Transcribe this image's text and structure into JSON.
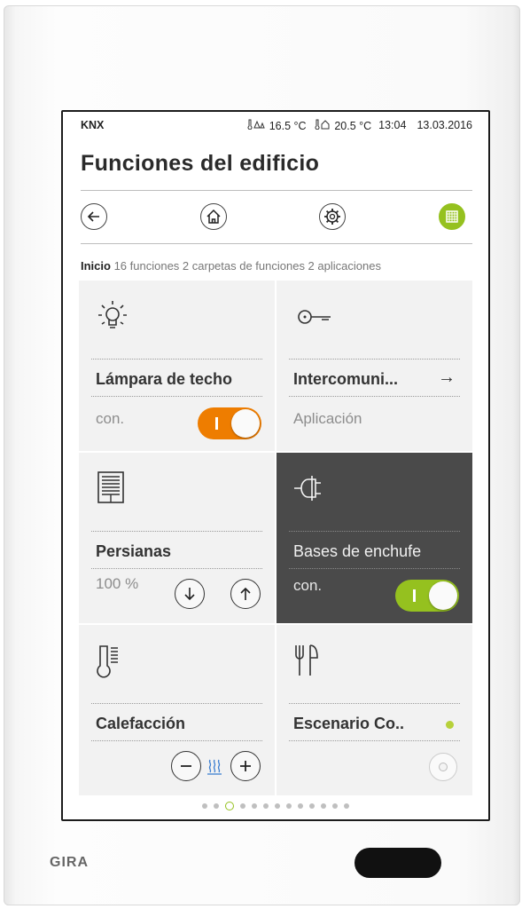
{
  "device": {
    "brand": "GIRA"
  },
  "statusbar": {
    "system": "KNX",
    "outdoor_icon": "🌡⚠",
    "outdoor_temp": "16.5 °C",
    "indoor_icon": "🌡⌂",
    "indoor_temp": "20.5 °C",
    "time": "13:04",
    "date": "13.03.2016"
  },
  "page": {
    "title": "Funciones del edificio"
  },
  "nav": {
    "back": "back-arrow-icon",
    "home": "home-icon",
    "settings": "gear-icon",
    "view": "grid-view-icon",
    "accent": "#95c11f"
  },
  "breadcrumb": {
    "current": "Inicio",
    "summary": "16 funciones 2 carpetas de funciones 2 aplicaciones"
  },
  "tiles": [
    {
      "name": "Lámpara de techo",
      "status": "con.",
      "icon": "lightbulb-icon",
      "toggle_color": "#ee7d00",
      "on": true
    },
    {
      "name": "Intercomuni...",
      "status": "Aplicación",
      "icon": "key-icon",
      "arrow": "→"
    },
    {
      "name": "Persianas",
      "status": "100 %",
      "icon": "blinds-icon"
    },
    {
      "name": "Bases de enchufe",
      "status": "con.",
      "icon": "plug-icon",
      "toggle_color": "#95c11f",
      "on": true,
      "selected": true
    },
    {
      "name": "Calefacción",
      "icon": "thermometer-icon",
      "mode_icon": "heating-icon"
    },
    {
      "name": "Escenario Co..",
      "icon": "fork-knife-icon",
      "indicator_color": "#b7d13a"
    }
  ],
  "pager": {
    "count": 13,
    "current_index": 2
  }
}
